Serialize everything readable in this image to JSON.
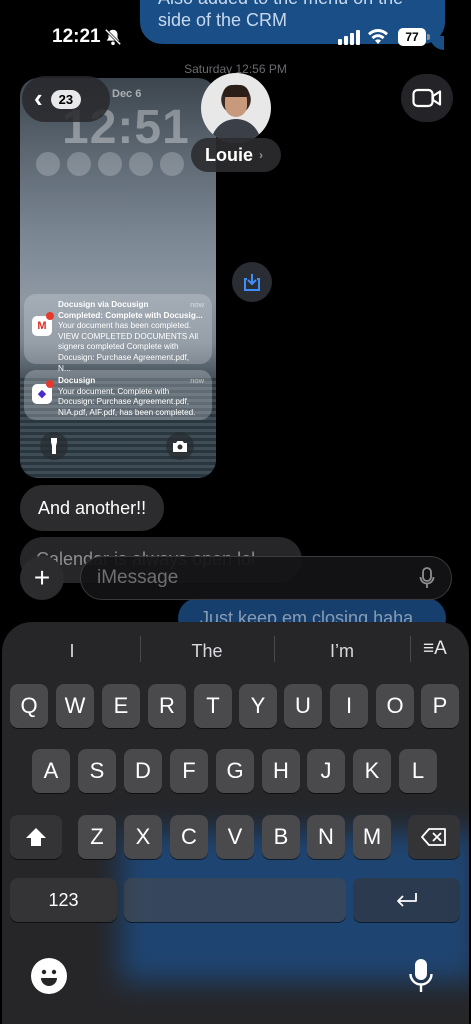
{
  "status_bar": {
    "time": "12:21",
    "battery": "77"
  },
  "top_message": {
    "line1": "Also added to the menu on the",
    "line2": "side of the CRM"
  },
  "timestamp": "Saturday 12:56 PM",
  "nav": {
    "back_count": "23",
    "contact_name": "Louie"
  },
  "screenshot": {
    "date": "Dec 6",
    "clock": "12:51",
    "notifications": [
      {
        "title": "Docusign via Docusign",
        "subtitle": "Completed: Complete with Docusig...",
        "body": "Your document has been completed. VIEW COMPLETED DOCUMENTS All signers completed Complete with Docusign: Purchase Agreement.pdf, N...",
        "time": "now",
        "icon": "gmail-icon"
      },
      {
        "title": "Docusign",
        "subtitle": "",
        "body": "Your document, Complete with Docusign: Purchase Agreement.pdf, NIA.pdf, AIF.pdf, has been completed.",
        "time": "now",
        "icon": "docusign-icon"
      }
    ]
  },
  "messages": [
    {
      "sender": "them",
      "text": "And another!!"
    },
    {
      "sender": "them",
      "text": "Calendar is always open lol"
    },
    {
      "sender": "me",
      "text": "Just keep em closing haha"
    }
  ],
  "composer": {
    "placeholder": "iMessage"
  },
  "keyboard": {
    "suggestions": [
      "I",
      "The",
      "I’m"
    ],
    "row1": [
      "Q",
      "W",
      "E",
      "R",
      "T",
      "Y",
      "U",
      "I",
      "O",
      "P"
    ],
    "row2": [
      "A",
      "S",
      "D",
      "F",
      "G",
      "H",
      "J",
      "K",
      "L"
    ],
    "row3": [
      "Z",
      "X",
      "C",
      "V",
      "B",
      "N",
      "M"
    ],
    "numbers_label": "123"
  },
  "colors": {
    "imessage_blue": "#1c4f8a",
    "bubble_gray": "#2c2c2e",
    "key_bg": "#4a4a4d"
  }
}
